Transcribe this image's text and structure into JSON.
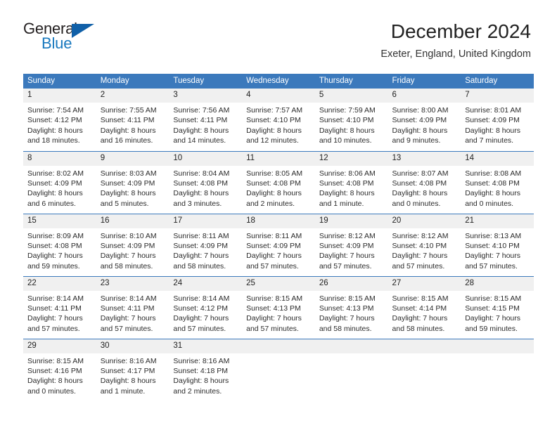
{
  "logo": {
    "word_top": "General",
    "word_bottom": "Blue",
    "accent_color": "#1060a8"
  },
  "header": {
    "title": "December 2024",
    "subtitle": "Exeter, England, United Kingdom"
  },
  "theme": {
    "header_blue": "#3b79bc",
    "daynum_gray": "#f0f0f0"
  },
  "weekday_headers": [
    "Sunday",
    "Monday",
    "Tuesday",
    "Wednesday",
    "Thursday",
    "Friday",
    "Saturday"
  ],
  "weeks": [
    [
      {
        "day": "1",
        "sunrise": "Sunrise: 7:54 AM",
        "sunset": "Sunset: 4:12 PM",
        "daylight1": "Daylight: 8 hours",
        "daylight2": "and 18 minutes."
      },
      {
        "day": "2",
        "sunrise": "Sunrise: 7:55 AM",
        "sunset": "Sunset: 4:11 PM",
        "daylight1": "Daylight: 8 hours",
        "daylight2": "and 16 minutes."
      },
      {
        "day": "3",
        "sunrise": "Sunrise: 7:56 AM",
        "sunset": "Sunset: 4:11 PM",
        "daylight1": "Daylight: 8 hours",
        "daylight2": "and 14 minutes."
      },
      {
        "day": "4",
        "sunrise": "Sunrise: 7:57 AM",
        "sunset": "Sunset: 4:10 PM",
        "daylight1": "Daylight: 8 hours",
        "daylight2": "and 12 minutes."
      },
      {
        "day": "5",
        "sunrise": "Sunrise: 7:59 AM",
        "sunset": "Sunset: 4:10 PM",
        "daylight1": "Daylight: 8 hours",
        "daylight2": "and 10 minutes."
      },
      {
        "day": "6",
        "sunrise": "Sunrise: 8:00 AM",
        "sunset": "Sunset: 4:09 PM",
        "daylight1": "Daylight: 8 hours",
        "daylight2": "and 9 minutes."
      },
      {
        "day": "7",
        "sunrise": "Sunrise: 8:01 AM",
        "sunset": "Sunset: 4:09 PM",
        "daylight1": "Daylight: 8 hours",
        "daylight2": "and 7 minutes."
      }
    ],
    [
      {
        "day": "8",
        "sunrise": "Sunrise: 8:02 AM",
        "sunset": "Sunset: 4:09 PM",
        "daylight1": "Daylight: 8 hours",
        "daylight2": "and 6 minutes."
      },
      {
        "day": "9",
        "sunrise": "Sunrise: 8:03 AM",
        "sunset": "Sunset: 4:09 PM",
        "daylight1": "Daylight: 8 hours",
        "daylight2": "and 5 minutes."
      },
      {
        "day": "10",
        "sunrise": "Sunrise: 8:04 AM",
        "sunset": "Sunset: 4:08 PM",
        "daylight1": "Daylight: 8 hours",
        "daylight2": "and 3 minutes."
      },
      {
        "day": "11",
        "sunrise": "Sunrise: 8:05 AM",
        "sunset": "Sunset: 4:08 PM",
        "daylight1": "Daylight: 8 hours",
        "daylight2": "and 2 minutes."
      },
      {
        "day": "12",
        "sunrise": "Sunrise: 8:06 AM",
        "sunset": "Sunset: 4:08 PM",
        "daylight1": "Daylight: 8 hours",
        "daylight2": "and 1 minute."
      },
      {
        "day": "13",
        "sunrise": "Sunrise: 8:07 AM",
        "sunset": "Sunset: 4:08 PM",
        "daylight1": "Daylight: 8 hours",
        "daylight2": "and 0 minutes."
      },
      {
        "day": "14",
        "sunrise": "Sunrise: 8:08 AM",
        "sunset": "Sunset: 4:08 PM",
        "daylight1": "Daylight: 8 hours",
        "daylight2": "and 0 minutes."
      }
    ],
    [
      {
        "day": "15",
        "sunrise": "Sunrise: 8:09 AM",
        "sunset": "Sunset: 4:08 PM",
        "daylight1": "Daylight: 7 hours",
        "daylight2": "and 59 minutes."
      },
      {
        "day": "16",
        "sunrise": "Sunrise: 8:10 AM",
        "sunset": "Sunset: 4:09 PM",
        "daylight1": "Daylight: 7 hours",
        "daylight2": "and 58 minutes."
      },
      {
        "day": "17",
        "sunrise": "Sunrise: 8:11 AM",
        "sunset": "Sunset: 4:09 PM",
        "daylight1": "Daylight: 7 hours",
        "daylight2": "and 58 minutes."
      },
      {
        "day": "18",
        "sunrise": "Sunrise: 8:11 AM",
        "sunset": "Sunset: 4:09 PM",
        "daylight1": "Daylight: 7 hours",
        "daylight2": "and 57 minutes."
      },
      {
        "day": "19",
        "sunrise": "Sunrise: 8:12 AM",
        "sunset": "Sunset: 4:09 PM",
        "daylight1": "Daylight: 7 hours",
        "daylight2": "and 57 minutes."
      },
      {
        "day": "20",
        "sunrise": "Sunrise: 8:12 AM",
        "sunset": "Sunset: 4:10 PM",
        "daylight1": "Daylight: 7 hours",
        "daylight2": "and 57 minutes."
      },
      {
        "day": "21",
        "sunrise": "Sunrise: 8:13 AM",
        "sunset": "Sunset: 4:10 PM",
        "daylight1": "Daylight: 7 hours",
        "daylight2": "and 57 minutes."
      }
    ],
    [
      {
        "day": "22",
        "sunrise": "Sunrise: 8:14 AM",
        "sunset": "Sunset: 4:11 PM",
        "daylight1": "Daylight: 7 hours",
        "daylight2": "and 57 minutes."
      },
      {
        "day": "23",
        "sunrise": "Sunrise: 8:14 AM",
        "sunset": "Sunset: 4:11 PM",
        "daylight1": "Daylight: 7 hours",
        "daylight2": "and 57 minutes."
      },
      {
        "day": "24",
        "sunrise": "Sunrise: 8:14 AM",
        "sunset": "Sunset: 4:12 PM",
        "daylight1": "Daylight: 7 hours",
        "daylight2": "and 57 minutes."
      },
      {
        "day": "25",
        "sunrise": "Sunrise: 8:15 AM",
        "sunset": "Sunset: 4:13 PM",
        "daylight1": "Daylight: 7 hours",
        "daylight2": "and 57 minutes."
      },
      {
        "day": "26",
        "sunrise": "Sunrise: 8:15 AM",
        "sunset": "Sunset: 4:13 PM",
        "daylight1": "Daylight: 7 hours",
        "daylight2": "and 58 minutes."
      },
      {
        "day": "27",
        "sunrise": "Sunrise: 8:15 AM",
        "sunset": "Sunset: 4:14 PM",
        "daylight1": "Daylight: 7 hours",
        "daylight2": "and 58 minutes."
      },
      {
        "day": "28",
        "sunrise": "Sunrise: 8:15 AM",
        "sunset": "Sunset: 4:15 PM",
        "daylight1": "Daylight: 7 hours",
        "daylight2": "and 59 minutes."
      }
    ],
    [
      {
        "day": "29",
        "sunrise": "Sunrise: 8:15 AM",
        "sunset": "Sunset: 4:16 PM",
        "daylight1": "Daylight: 8 hours",
        "daylight2": "and 0 minutes."
      },
      {
        "day": "30",
        "sunrise": "Sunrise: 8:16 AM",
        "sunset": "Sunset: 4:17 PM",
        "daylight1": "Daylight: 8 hours",
        "daylight2": "and 1 minute."
      },
      {
        "day": "31",
        "sunrise": "Sunrise: 8:16 AM",
        "sunset": "Sunset: 4:18 PM",
        "daylight1": "Daylight: 8 hours",
        "daylight2": "and 2 minutes."
      },
      {
        "day": "",
        "sunrise": "",
        "sunset": "",
        "daylight1": "",
        "daylight2": ""
      },
      {
        "day": "",
        "sunrise": "",
        "sunset": "",
        "daylight1": "",
        "daylight2": ""
      },
      {
        "day": "",
        "sunrise": "",
        "sunset": "",
        "daylight1": "",
        "daylight2": ""
      },
      {
        "day": "",
        "sunrise": "",
        "sunset": "",
        "daylight1": "",
        "daylight2": ""
      }
    ]
  ]
}
